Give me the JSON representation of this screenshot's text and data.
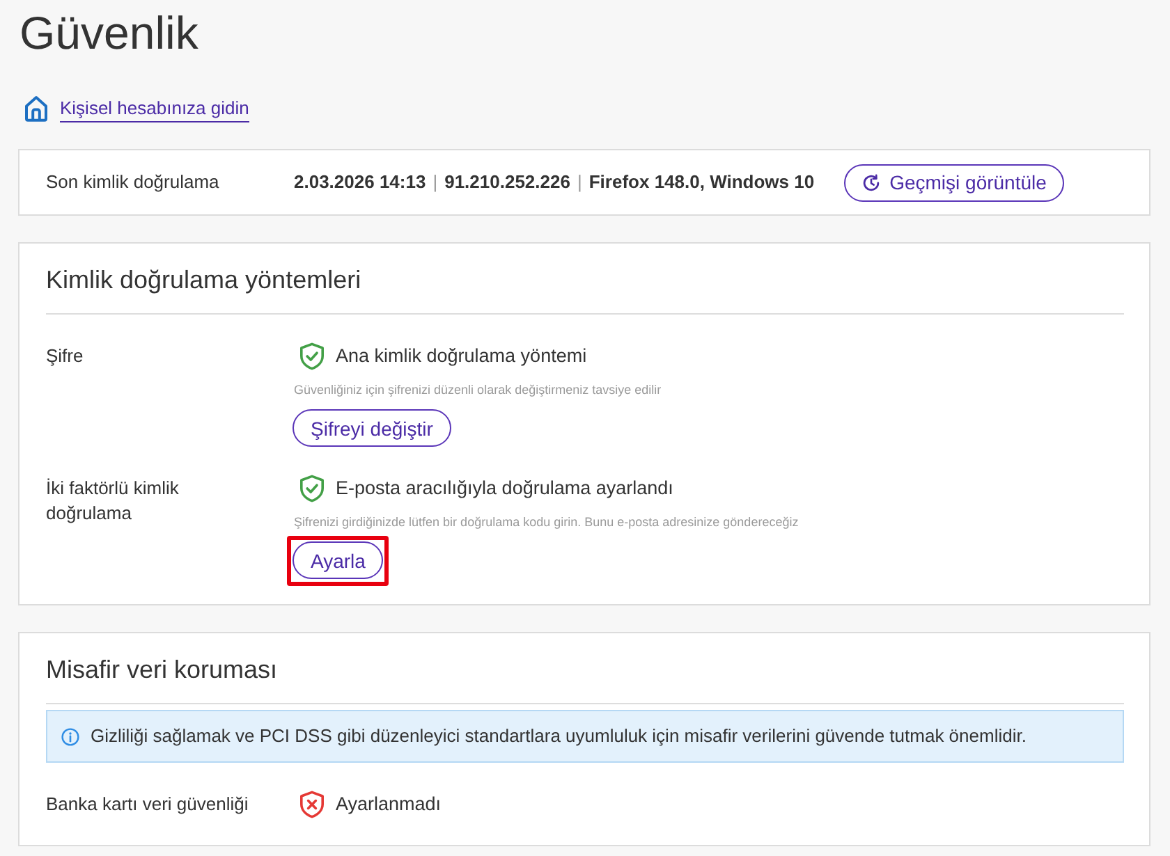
{
  "page": {
    "title": "Güvenlik"
  },
  "account_link": {
    "label": "Kişisel hesabınıza gidin"
  },
  "last_authentication": {
    "label": "Son kimlik doğrulama",
    "details": [
      "2.03.2026 14:13",
      "91.210.252.226",
      "Firefox 148.0, Windows 10"
    ],
    "separators": [
      "|",
      "|"
    ],
    "button": "Geçmişi görüntüle"
  },
  "auth_methods": {
    "title": "Kimlik doğrulama yöntemleri",
    "rows": [
      {
        "label": "Şifre",
        "configured": true,
        "status_text": "Ana kimlik doğrulama yöntemi",
        "hint": "Güvenliğiniz için şifrenizi düzenli olarak değiştirmeniz tavsiye edilir",
        "button": "Şifreyi değiştir",
        "highlighted": false
      },
      {
        "label": "İki faktörlü kimlik doğrulama",
        "configured": true,
        "status_text": "E-posta aracılığıyla doğrulama ayarlandı",
        "hint": "Şifrenizi girdiğinizde lütfen bir doğrulama kodu girin. Bunu e-posta adresinize göndereceğiz",
        "button": "Ayarla",
        "highlighted": true
      }
    ]
  },
  "guest_data_protection": {
    "title": "Misafir veri koruması",
    "notice": "Gizliliği sağlamak ve PCI DSS gibi düzenleyici standartlara uyumluluk için misafir verilerini güvende tutmak önemlidir.",
    "rows": [
      {
        "label": "Banka kartı veri güvenliği",
        "configured": false,
        "status_text": "Ayarlanmadı"
      }
    ]
  }
}
